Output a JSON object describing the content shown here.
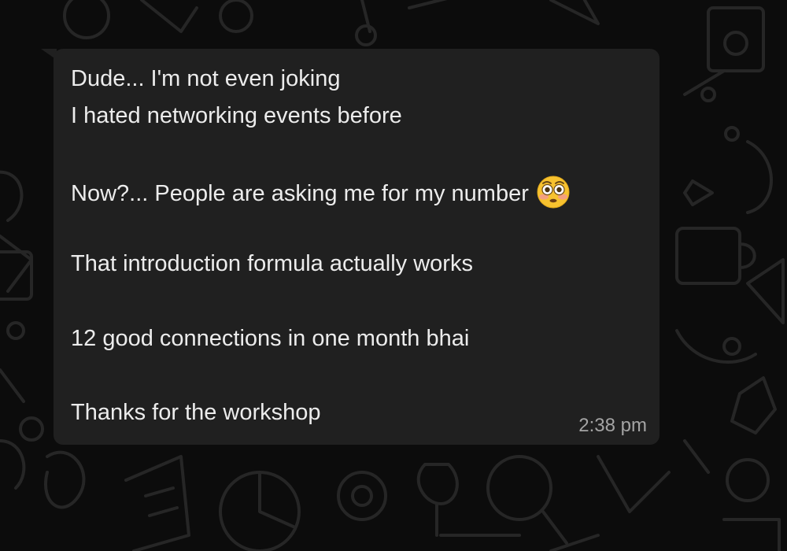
{
  "message": {
    "lines": [
      "Dude... I'm not even joking",
      "I hated networking events before",
      "Now?... People are asking me for my number",
      "That introduction formula actually works",
      "12 good connections in one month bhai",
      "Thanks for the workshop"
    ],
    "emoji": "flushed-face",
    "timestamp": "2:38 pm"
  },
  "colors": {
    "background": "#0c0c0c",
    "bubble": "#202020",
    "text": "#ececec",
    "timestamp": "#a4a4a4"
  }
}
